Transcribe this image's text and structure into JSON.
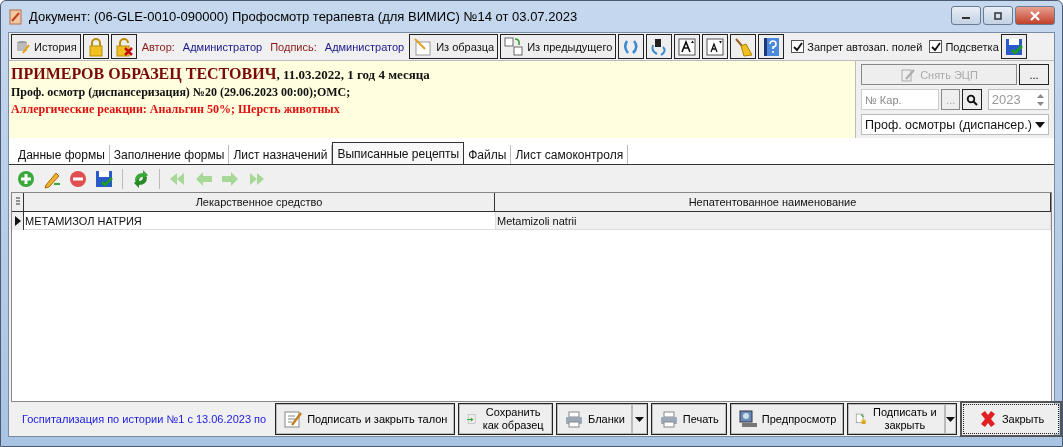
{
  "window": {
    "title": "Документ: (06-GLE-0010-090000) Профосмотр терапевта (для ВИМИС) №14 от 03.07.2023"
  },
  "toolbar": {
    "history_button": {
      "label": "История"
    },
    "author": {
      "label": "Автор:",
      "value": "Администратор"
    },
    "signature": {
      "label": "Подпись:",
      "value": "Администратор"
    },
    "from_template_button": {
      "label": "Из образца"
    },
    "from_previous_button": {
      "label": "Из предыдущего"
    },
    "checkboxes": [
      {
        "label": "Запрет автозап. полей",
        "checked": true
      },
      {
        "label": "Подсветка",
        "checked": true
      }
    ]
  },
  "patient": {
    "name": "ПРИМЕРОВ ОБРАЗЕЦ ТЕСТОВИЧ",
    "details": ", 11.03.2022, 1 год 4 месяца",
    "visit": "Проф. осмотр (диспансеризация) №20 (29.06.2023 00:00);ОМС;",
    "allergies": "Аллергические реакции: Анальгин 50%; Шерсть животных"
  },
  "side_panel": {
    "remove_signature_button": {
      "label": "Снять ЭЦП",
      "disabled": true
    },
    "more_button": {
      "label": "..."
    },
    "card_field": {
      "placeholder": "№ Кар."
    },
    "card_browse_button": {
      "label": "...",
      "disabled": true
    },
    "year_field": {
      "value": "2023",
      "disabled": true
    },
    "type_dropdown": {
      "value": "Проф. осмотры (диспансер.)"
    }
  },
  "tabs": [
    {
      "label": "Данные формы",
      "selected": false
    },
    {
      "label": "Заполнение формы",
      "selected": false
    },
    {
      "label": "Лист назначений",
      "selected": false
    },
    {
      "label": "Выписанные рецепты",
      "selected": true
    },
    {
      "label": "Файлы",
      "selected": false
    },
    {
      "label": "Лист самоконтроля",
      "selected": false
    }
  ],
  "grid_toolbar": [
    {
      "disabled": false
    },
    {
      "disabled": false
    },
    {
      "disabled": false
    },
    {
      "disabled": false
    },
    {
      "disabled": false
    },
    {
      "disabled": true
    },
    {
      "disabled": true
    },
    {
      "disabled": true
    },
    {
      "disabled": true
    }
  ],
  "table": {
    "columns": [
      "Лекарственное средство",
      "Непатентованное наименование"
    ],
    "rows": [
      {
        "cells": [
          "МЕТАМИЗОЛ НАТРИЯ",
          "Metamizoli natrii"
        ],
        "selected": true
      }
    ]
  },
  "status_text": "Госпитализация по истории №1 с 13.06.2023 по",
  "buttons": [
    {
      "label": "Подписать и закрыть талон",
      "dropdown": false,
      "default": false
    },
    {
      "label": "Сохранить как образец",
      "dropdown": false,
      "default": false
    },
    {
      "label": "Бланки",
      "dropdown": true,
      "default": false
    },
    {
      "label": "Печать",
      "dropdown": false,
      "default": false
    },
    {
      "label": "Предпросмотр",
      "dropdown": false,
      "default": false
    },
    {
      "label": "Подписать и закрыть",
      "dropdown": true,
      "default": false
    },
    {
      "label": "Закрыть",
      "dropdown": false,
      "default": true
    }
  ]
}
